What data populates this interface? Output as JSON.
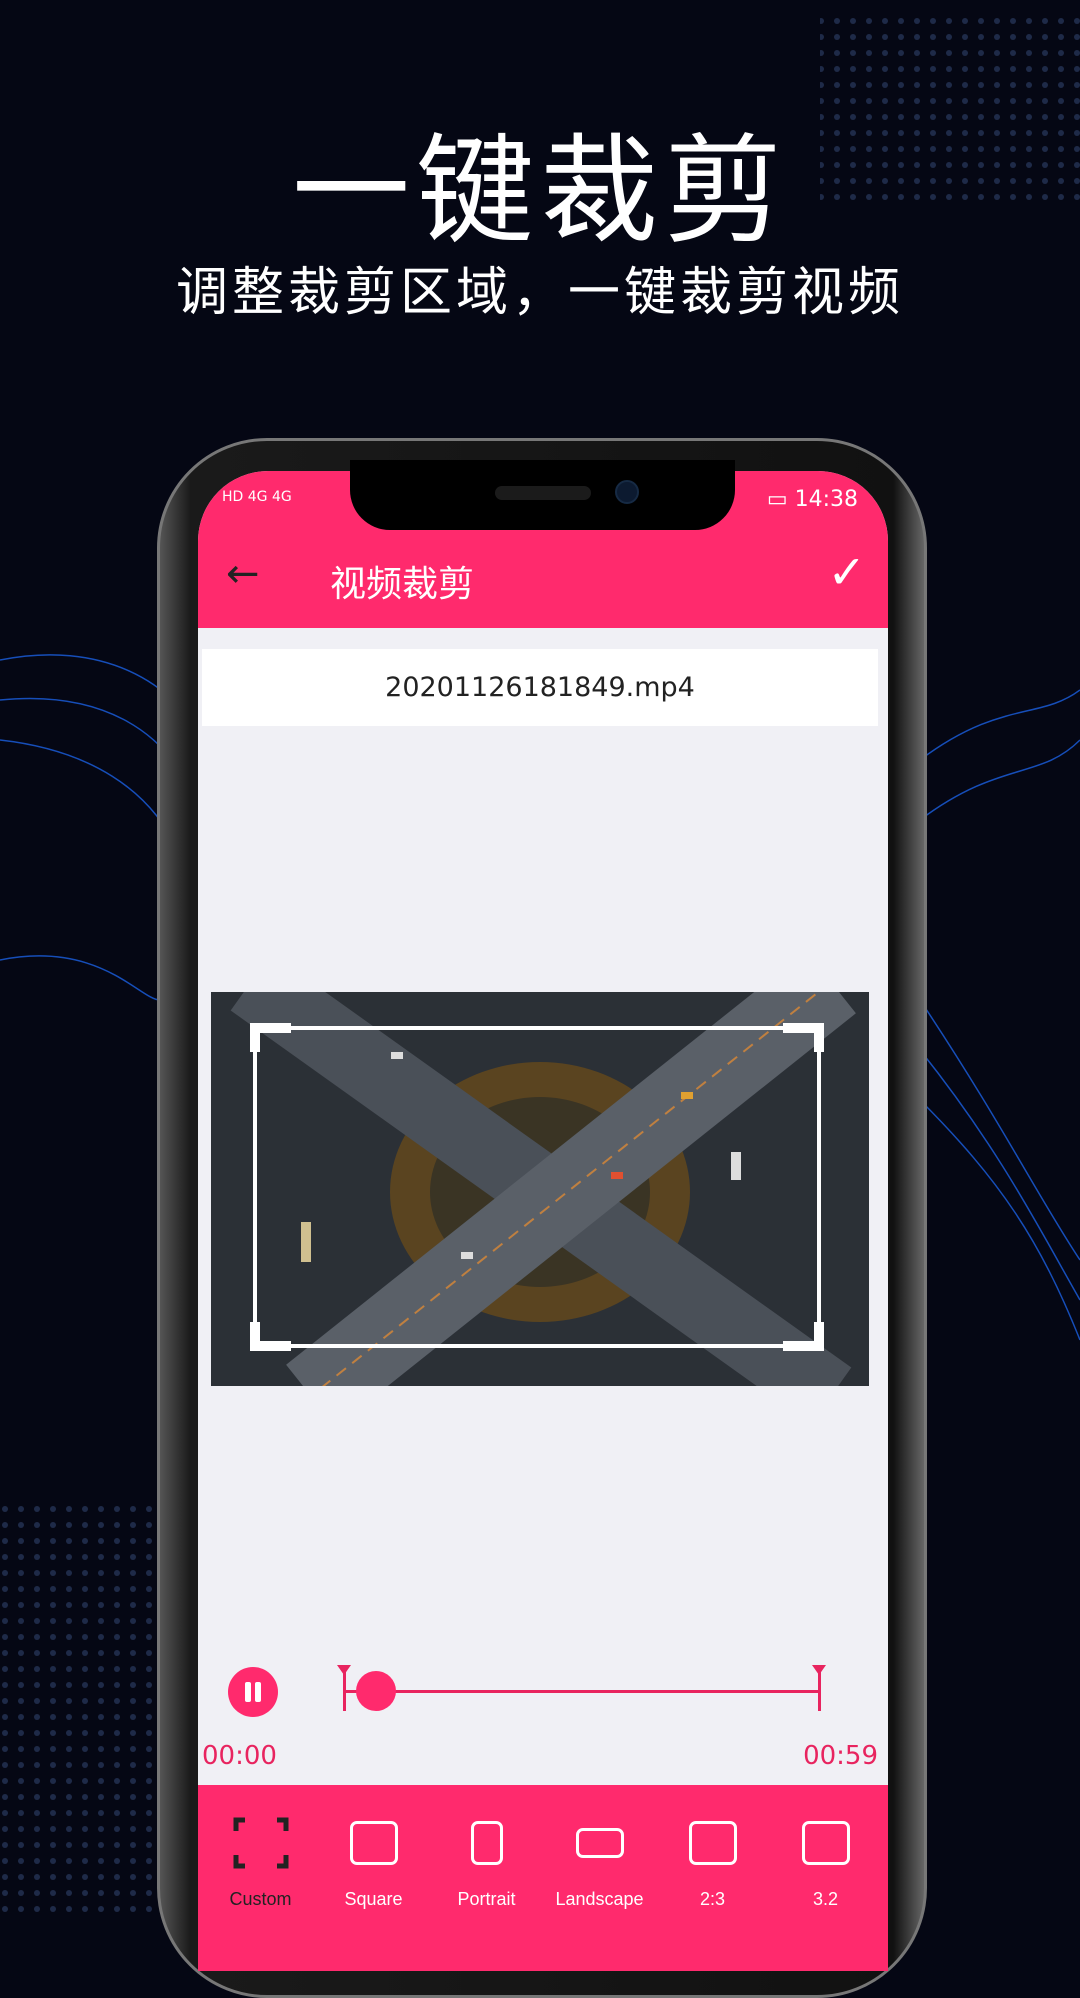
{
  "headline": "一键裁剪",
  "subheadline": "调整裁剪区域，一键裁剪视频",
  "status_bar": {
    "left": "HD 4G 4G",
    "time": "14:38"
  },
  "app_bar": {
    "title": "视频裁剪",
    "back_icon": "arrow-left-icon",
    "confirm_icon": "check-icon"
  },
  "file_name": "20201126181849.mp4",
  "player": {
    "start_time": "00:00",
    "end_time": "00:59",
    "state": "playing",
    "progress_percent": 7
  },
  "crop_options": [
    {
      "label": "Custom",
      "icon": "crop-corners-icon",
      "active": true
    },
    {
      "label": "Square",
      "icon": "square-icon"
    },
    {
      "label": "Portrait",
      "icon": "portrait-icon"
    },
    {
      "label": "Landscape",
      "icon": "landscape-icon"
    },
    {
      "label": "2:3",
      "icon": "ratio-icon"
    },
    {
      "label": "3.2",
      "icon": "ratio-icon"
    }
  ],
  "colors": {
    "accent": "#ff2a6d",
    "background": "#050714"
  }
}
